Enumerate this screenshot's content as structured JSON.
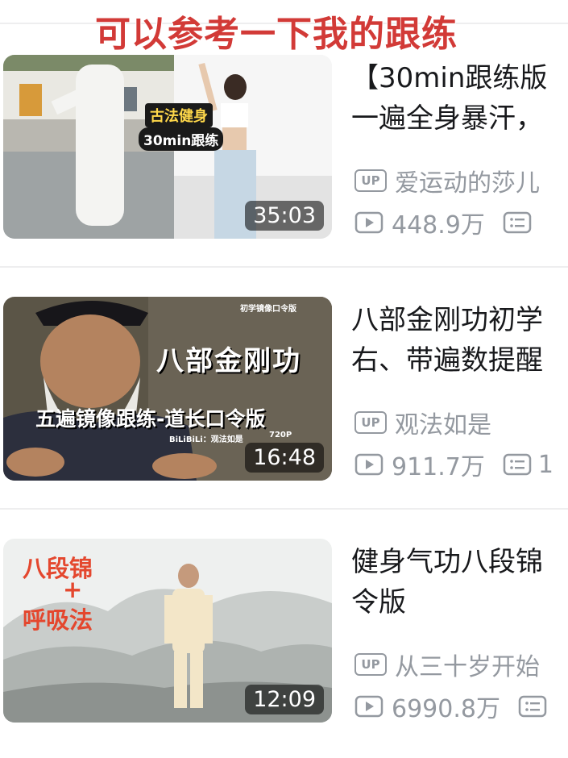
{
  "overlay_caption": "可以参考一下我的跟练",
  "videos": [
    {
      "title_line1": "【30min跟练版",
      "title_line2": "一遍全身暴汗，",
      "uploader": "爱运动的莎儿",
      "views": "448.9万",
      "duration": "35:03",
      "thumb_tag1": "古法健身",
      "thumb_tag2": "30min跟练"
    },
    {
      "title_line1": "八部金刚功初学",
      "title_line2": "右、带遍数提醒",
      "uploader": "观法如是",
      "views": "911.7万",
      "extra": "1",
      "duration": "16:48",
      "thumb_corner": "初学镜像口令版",
      "thumb_title": "八部金刚功",
      "thumb_sub": "五遍镜像跟练-道长口令版",
      "thumb_watermark": "BiLiBiLi：观法如是",
      "thumb_quality": "720P"
    },
    {
      "title_line1": "健身气功八段锦",
      "title_line2": "令版",
      "uploader": "从三十岁开始",
      "views": "6990.8万",
      "duration": "12:09",
      "thumb_line1": "八段锦",
      "thumb_line2": "+",
      "thumb_line3": "呼吸法"
    }
  ],
  "icons": {
    "uploader": "up-badge-icon",
    "views": "play-count-icon",
    "comments": "list-icon"
  },
  "colors": {
    "caption": "#d23a37",
    "title_text": "#18191c",
    "meta_text": "#9499a0",
    "divider": "#eeeeef"
  }
}
